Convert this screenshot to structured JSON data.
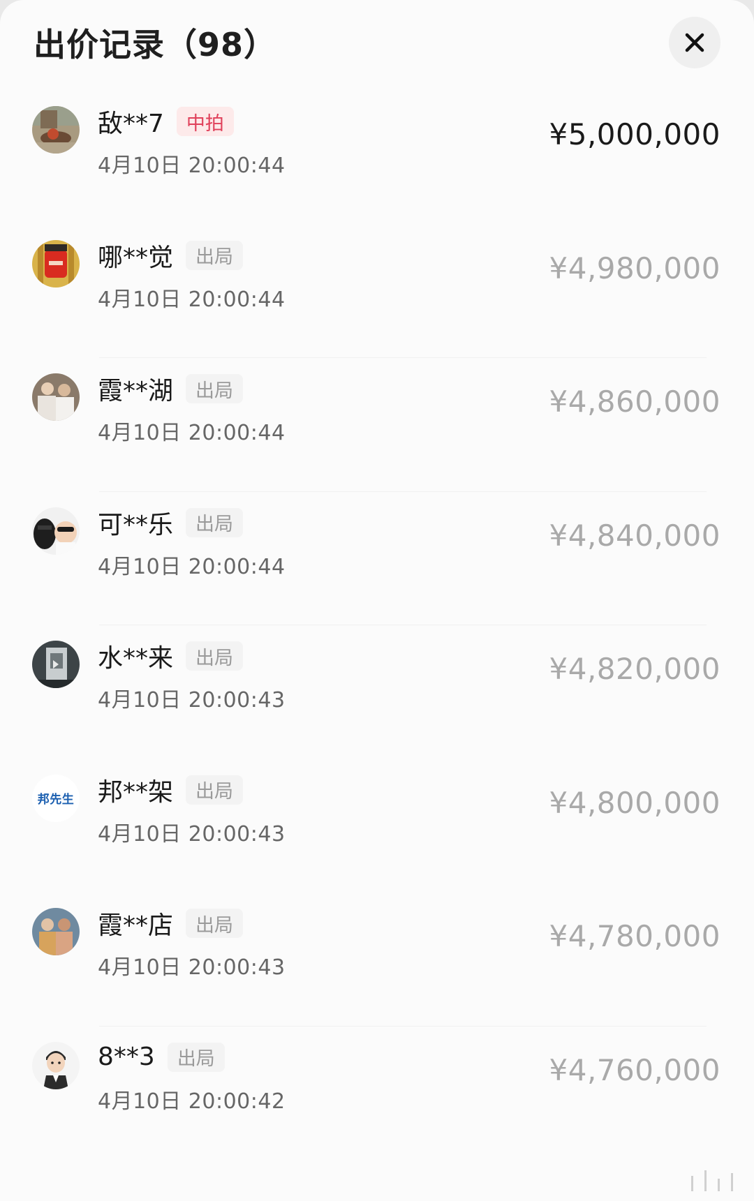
{
  "header": {
    "title": "出价记录（98）"
  },
  "bids": [
    {
      "name": "敌**7",
      "tag": "中拍",
      "time": "4月10日 20:00:44",
      "price": "¥5,000,000",
      "status": "winner"
    },
    {
      "name": "哪**觉",
      "tag": "出局",
      "time": "4月10日 20:00:44",
      "price": "¥4,980,000",
      "status": "out"
    },
    {
      "name": "霞**湖",
      "tag": "出局",
      "time": "4月10日 20:00:44",
      "price": "¥4,860,000",
      "status": "out"
    },
    {
      "name": "可**乐",
      "tag": "出局",
      "time": "4月10日 20:00:44",
      "price": "¥4,840,000",
      "status": "out"
    },
    {
      "name": "水**来",
      "tag": "出局",
      "time": "4月10日 20:00:43",
      "price": "¥4,820,000",
      "status": "out"
    },
    {
      "name": "邦**架",
      "tag": "出局",
      "time": "4月10日 20:00:43",
      "price": "¥4,800,000",
      "status": "out",
      "avatar_text": "邦先生"
    },
    {
      "name": "霞**店",
      "tag": "出局",
      "time": "4月10日 20:00:43",
      "price": "¥4,780,000",
      "status": "out"
    },
    {
      "name": "8**3",
      "tag": "出局",
      "time": "4月10日 20:00:42",
      "price": "¥4,760,000",
      "status": "out"
    }
  ],
  "colors": {
    "win_tag_bg": "#fdeaea",
    "win_tag_text": "#e0405a",
    "out_tag_bg": "#f3f3f3",
    "out_tag_text": "#9a9a9a"
  },
  "icons": {
    "close": "close-icon"
  }
}
